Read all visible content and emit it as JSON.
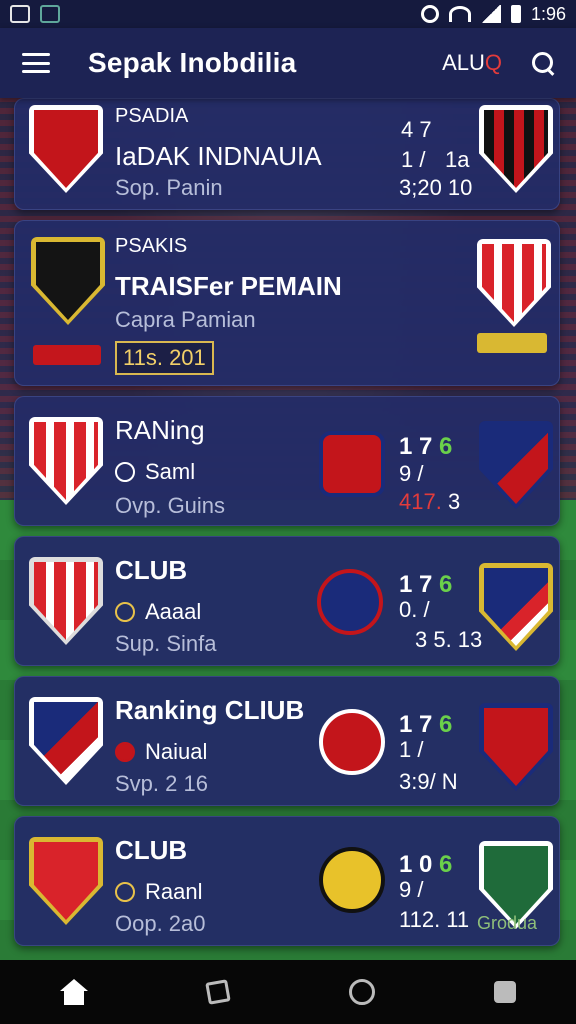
{
  "status": {
    "time": "1:96"
  },
  "appbar": {
    "title": "Sepak Inobdilia",
    "action_text": "ALU",
    "action_q": "Q"
  },
  "cards": [
    {
      "kicker": "PSADIA",
      "title": "IaDAK INDNAUIA",
      "sub": "Sop. Panin",
      "s1": "4 7",
      "s2": "1 /",
      "s2b": "1a",
      "s3": "3;20 10"
    },
    {
      "kicker": "PSAKIS",
      "title": "TRAISFer PEMAIN",
      "sub": "Capra Pamian",
      "tag": "11s. 201"
    },
    {
      "title": "RANing",
      "line": "Saml",
      "sub": "Ovp. Guins",
      "s1": "1 7",
      "s1g": "6",
      "s2": "9 /",
      "s3r": "417.",
      "s3": "3"
    },
    {
      "title": "CLUB",
      "line": "Aaaal",
      "sub": "Sup. Sinfa",
      "s1": "1 7",
      "s1g": "6",
      "s2": "0. /",
      "s3": "3 5. 13"
    },
    {
      "title": "Ranking CLIUB",
      "line": "Naiual",
      "sub": "Svp. 2 16",
      "s1": "1 7",
      "s1g": "6",
      "s2": "1 /",
      "s3": "3:9/ N"
    },
    {
      "title": "CLUB",
      "line": "Raanl",
      "sub": "Oop. 2a0",
      "s1": "1 0",
      "s1g": "6",
      "s2": "9 /",
      "s3": "112. 11",
      "badge": "Grodua"
    }
  ]
}
